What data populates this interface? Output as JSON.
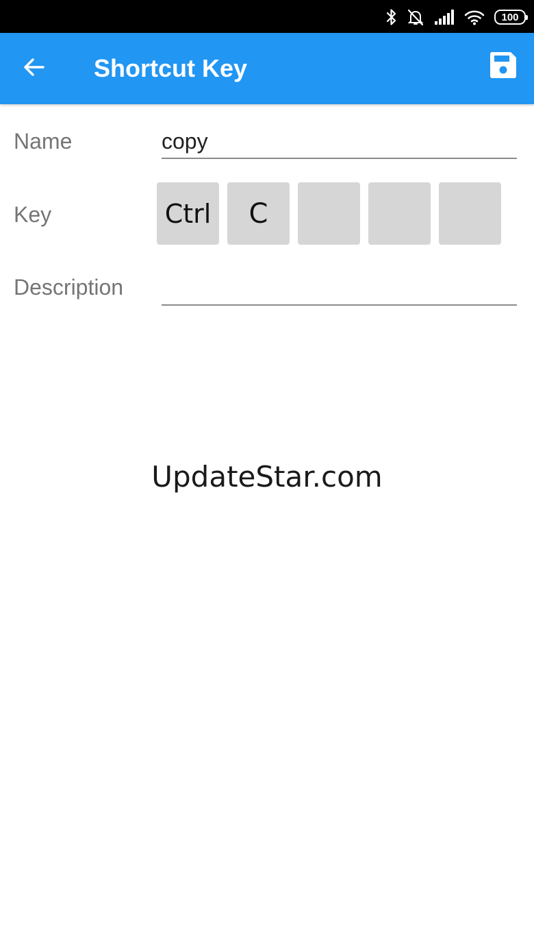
{
  "status_bar": {
    "icons": [
      "bluetooth-icon",
      "notifications-off-icon",
      "signal-icon",
      "wifi-icon",
      "battery-icon"
    ],
    "battery_level": "100"
  },
  "app_bar": {
    "title": "Shortcut Key",
    "back_icon": "arrow-back-icon",
    "save_icon": "floppy-disk-icon",
    "background_color": "#2196F3"
  },
  "form": {
    "name_label": "Name",
    "name_value": "copy",
    "key_label": "Key",
    "keys": [
      "Ctrl",
      "C",
      "",
      "",
      ""
    ],
    "description_label": "Description",
    "description_value": ""
  },
  "watermark": "UpdateStar.com"
}
